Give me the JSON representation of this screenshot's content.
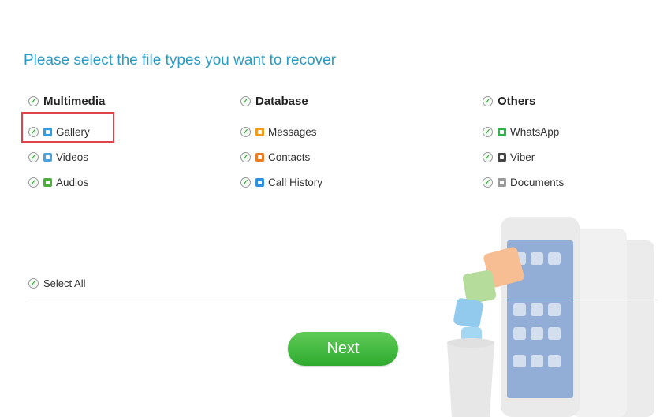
{
  "title": "Please select the file types you want to recover",
  "groups": [
    {
      "label": "Multimedia",
      "items": [
        {
          "label": "Gallery",
          "icon": "gallery-icon",
          "color": "#2f9ee6"
        },
        {
          "label": "Videos",
          "icon": "videos-icon",
          "color": "#4aa3e0"
        },
        {
          "label": "Audios",
          "icon": "audios-icon",
          "color": "#4caf3c"
        }
      ]
    },
    {
      "label": "Database",
      "items": [
        {
          "label": "Messages",
          "icon": "messages-icon",
          "color": "#f29b1d"
        },
        {
          "label": "Contacts",
          "icon": "contacts-icon",
          "color": "#f07a22"
        },
        {
          "label": "Call History",
          "icon": "call-history-icon",
          "color": "#2f8fe0"
        }
      ]
    },
    {
      "label": "Others",
      "items": [
        {
          "label": "WhatsApp",
          "icon": "whatsapp-icon",
          "color": "#2fb34a"
        },
        {
          "label": "Viber",
          "icon": "viber-icon",
          "color": "#444444"
        },
        {
          "label": "Documents",
          "icon": "documents-icon",
          "color": "#9a9a9a"
        }
      ]
    }
  ],
  "select_all": "Select All",
  "next_label": "Next",
  "colors": {
    "accent": "#2a9bc4",
    "button": "#3ab53a",
    "highlight": "#e0434b",
    "checkbox": "#3aa53a"
  }
}
